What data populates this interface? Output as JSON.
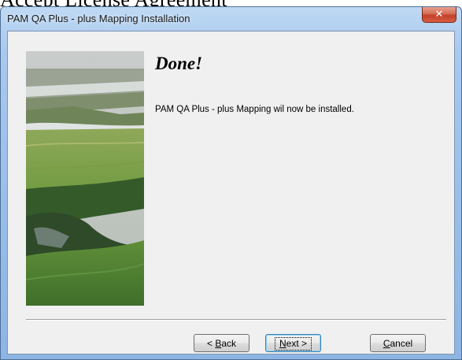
{
  "background_text": "Accept License Agreement",
  "window": {
    "title": "PAM QA Plus - plus Mapping Installation",
    "close_glyph": "✕"
  },
  "content": {
    "heading": "Done!",
    "message": "PAM QA Plus - plus Mapping wil now be installed."
  },
  "buttons": {
    "back": {
      "prefix": "< ",
      "mnemonic": "B",
      "rest": "ack"
    },
    "next": {
      "mnemonic": "N",
      "rest": "ext >"
    },
    "cancel": {
      "mnemonic": "C",
      "rest": "ancel"
    }
  },
  "colors": {
    "titlebar": "#a9c9ee",
    "client": "#f0f0f0",
    "close_button": "#c2402a"
  },
  "icons": [
    "close-icon",
    "landscape-image"
  ]
}
